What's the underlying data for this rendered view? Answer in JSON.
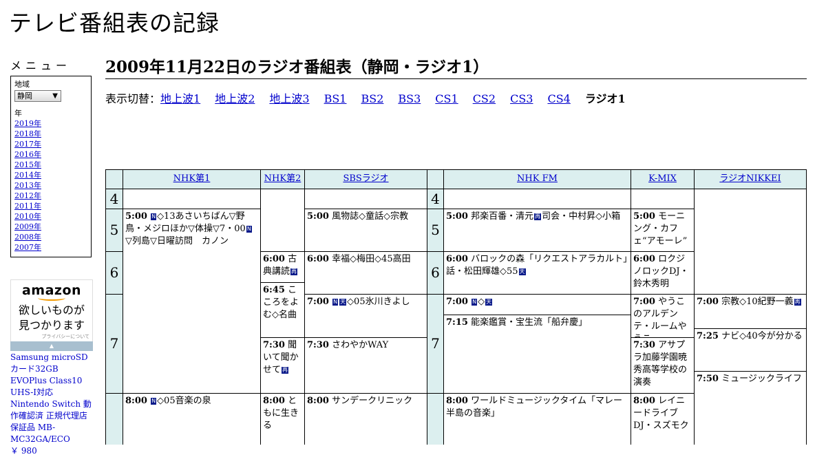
{
  "site": {
    "title": "テレビ番組表の記録"
  },
  "menu": {
    "heading": "メニュー",
    "region_label": "地域",
    "region_value": "静岡",
    "year_label": "年",
    "years": [
      "2019年",
      "2018年",
      "2017年",
      "2016年",
      "2015年",
      "2014年",
      "2013年",
      "2012年",
      "2011年",
      "2010年",
      "2009年",
      "2008年",
      "2007年"
    ]
  },
  "ad": {
    "logo": "amazon",
    "tagline_1": "欲しいものが",
    "tagline_2": "見つかります",
    "privacy": "プライバシーについて",
    "product": "Samsung microSDカード32GB EVOPlus Class10 UHS-I対応 Nintendo Switch 動作確認済 正規代理店保証品 MB-MC32GA/ECO",
    "price": "￥ 980"
  },
  "page": {
    "title": "2009年11月22日のラジオ番組表（静岡・ラジオ1）"
  },
  "switcher": {
    "label": "表示切替：",
    "links": [
      "地上波1",
      "地上波2",
      "地上波3",
      "BS1",
      "BS2",
      "BS3",
      "CS1",
      "CS2",
      "CS3",
      "CS4"
    ],
    "current": "ラジオ1"
  },
  "table": {
    "stations": [
      "NHK第1",
      "NHK第2",
      "SBSラジオ",
      "NHK FM",
      "K-MIX",
      "ラジオNIKKEI"
    ],
    "hours": [
      "4",
      "5",
      "6",
      "7",
      "8"
    ],
    "programs": {
      "nhk1_500_time": "5:00",
      "nhk1_500_a": "◇13あさいちばん▽野鳥・メジロほか▽体操▽7・00",
      "nhk1_500_b": "▽列島▽日曜訪問　カノン",
      "nhk1_800_time": "8:00",
      "nhk1_800_a": "◇05音楽の泉",
      "nhk2_600_time": "6:00",
      "nhk2_600_a": "古典講読",
      "nhk2_645_time": "6:45",
      "nhk2_645_a": "こころをよむ◇名曲",
      "nhk2_730_time": "7:30",
      "nhk2_730_a": "聞いて聞かせて",
      "nhk2_800_time": "8:00",
      "nhk2_800_a": "ともに生きる",
      "sbs_500_time": "5:00",
      "sbs_500_a": "風物誌◇童話◇宗教",
      "sbs_600_time": "6:00",
      "sbs_600_a": "幸福◇梅田◇45高田",
      "sbs_700_time": "7:00",
      "sbs_700_a": "◇05氷川きよし",
      "sbs_730_time": "7:30",
      "sbs_730_a": "さわやかWAY",
      "sbs_800_time": "8:00",
      "sbs_800_a": "サンデークリニック",
      "fm_500_time": "5:00",
      "fm_500_a": "邦楽百番・清元",
      "fm_500_b": "司会・中村昇◇小箱",
      "fm_600_time": "6:00",
      "fm_600_a": "バロックの森「リクエストアラカルト」話・松田輝雄◇55",
      "fm_700_time": "7:00",
      "fm_700_a": "◇",
      "fm_715_time": "7:15",
      "fm_715_a": "能楽鑑賞・宝生流「船弁慶」",
      "fm_800_time": "8:00",
      "fm_800_a": "ワールドミュージックタイム「マレー半島の音楽」",
      "kmix_500_time": "5:00",
      "kmix_500_a": "モーニング・カフェ“アモーレ”",
      "kmix_600_time": "6:00",
      "kmix_600_a": "ロクジノロックDJ・鈴木秀明",
      "kmix_700_time": "7:00",
      "kmix_700_a": "やうこのアルデンテ・ルームやうこ",
      "kmix_730_time": "7:30",
      "kmix_730_a": "アサプラ加藤学園暁秀高等学校の演奏",
      "kmix_800_time": "8:00",
      "kmix_800_a": "レイニードライブDJ・スズモク",
      "nikkei_700_time": "7:00",
      "nikkei_700_a": "宗教◇10紀野一義",
      "nikkei_725_time": "7:25",
      "nikkei_725_a": "ナビ◇40今が分かる",
      "nikkei_750_time": "7:50",
      "nikkei_750_a": "ミュージックライフ"
    },
    "marks": {
      "news": "N",
      "tenki": "天",
      "saihoso": "再"
    }
  },
  "colors": {
    "header_bg": "#dcefef",
    "link": "#0000cc",
    "mark_bg": "#0a1a8a"
  }
}
